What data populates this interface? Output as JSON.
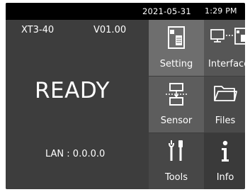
{
  "status_bar": {
    "date": "2021-05-31",
    "time": "1:29 PM"
  },
  "device": {
    "model": "XT3-40",
    "version": "V01.00",
    "state": "READY",
    "network": "LAN : 0.0.0.0"
  },
  "menu": {
    "tiles": [
      {
        "label": "Setting",
        "icon": "setting-icon"
      },
      {
        "label": "Interface",
        "icon": "interface-icon"
      },
      {
        "label": "Sensor",
        "icon": "sensor-icon"
      },
      {
        "label": "Files",
        "icon": "folder-icon"
      },
      {
        "label": "Tools",
        "icon": "tools-icon"
      },
      {
        "label": "Info",
        "icon": "info-icon"
      }
    ]
  },
  "colors": {
    "background": "#3d3d3d",
    "status_bar": "#000000",
    "text": "#ffffff"
  }
}
